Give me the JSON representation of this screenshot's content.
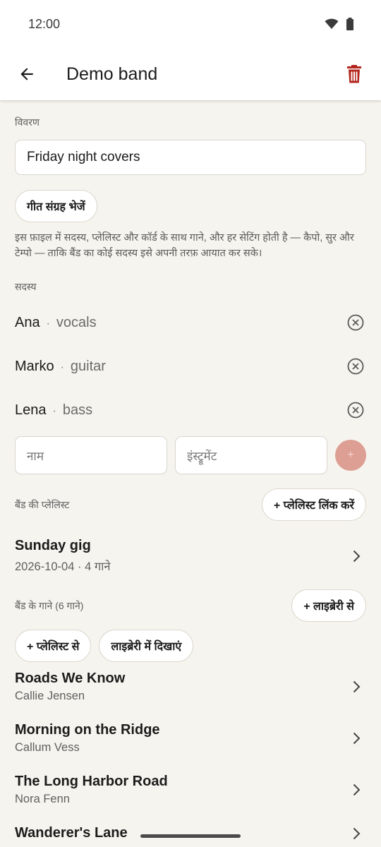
{
  "status_bar": {
    "time": "12:00",
    "wifi_icon": "wifi-icon",
    "battery_icon": "battery-icon"
  },
  "app_bar": {
    "title": "Demo band",
    "back_icon": "arrow-back-icon",
    "delete_icon": "trash-icon"
  },
  "description": {
    "label": "विवरण",
    "value": "Friday night covers"
  },
  "export": {
    "button_label": "गीत संग्रह भेजें",
    "helper_text": "इस फ़ाइल में सदस्य, प्लेलिस्ट और कॉर्ड के साथ गाने, और हर सेटिंग होती है — कैपो, सुर और टेम्पो — ताकि बैंड का कोई सदस्य इसे अपनी तरफ़ आयात कर सके।"
  },
  "members": {
    "label": "सदस्य",
    "items": [
      {
        "name": "Ana",
        "instrument": "vocals"
      },
      {
        "name": "Marko",
        "instrument": "guitar"
      },
      {
        "name": "Lena",
        "instrument": "bass"
      }
    ],
    "separator": "·",
    "name_placeholder": "नाम",
    "instrument_placeholder": "इंस्ट्रूमेंट",
    "add_label": "+"
  },
  "playlists": {
    "label": "बैंड की प्लेलिस्ट",
    "link_button": "+ प्लेलिस्ट लिंक करें",
    "items": [
      {
        "title": "Sunday gig",
        "subtitle": "2026-10-04  ·  4 गाने"
      }
    ]
  },
  "songs": {
    "label": "बैंड के गाने (6 गाने)",
    "from_library_button": "+ लाइब्रेरी से",
    "from_playlist_button": "+ प्लेलिस्ट से",
    "show_in_library_button": "लाइब्रेरी में दिखाएं",
    "items": [
      {
        "title": "Roads We Know",
        "artist": "Callie Jensen"
      },
      {
        "title": "Morning on the Ridge",
        "artist": "Callum Vess"
      },
      {
        "title": "The Long Harbor Road",
        "artist": "Nora Fenn"
      },
      {
        "title": "Wanderer's Lane",
        "artist": ""
      }
    ]
  },
  "colors": {
    "accent_red": "#b3261e",
    "background": "#f6f4ee",
    "fab_disabled": "#dd9f93"
  }
}
